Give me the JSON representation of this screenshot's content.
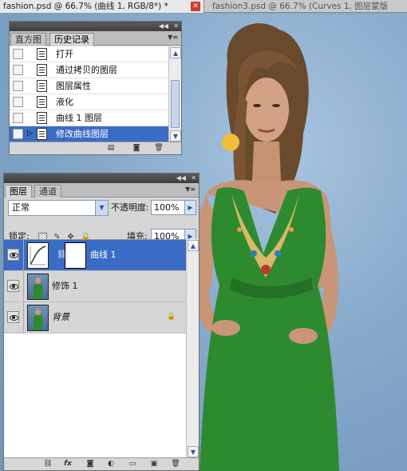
{
  "document_tabs": [
    {
      "label": "fashion.psd @ 66.7% (曲线 1, RGB/8*) *",
      "active": true
    },
    {
      "label": "fashion3.psd @ 66.7% (Curves 1, 图层蒙版",
      "active": false
    }
  ],
  "tab_close_glyph": "✕",
  "history_panel": {
    "tabs": [
      "直方图",
      "历史记录"
    ],
    "active_tab": "历史记录",
    "items": [
      {
        "label": "打开",
        "selected": false
      },
      {
        "label": "通过拷贝的图层",
        "selected": false
      },
      {
        "label": "图层属性",
        "selected": false
      },
      {
        "label": "液化",
        "selected": false
      },
      {
        "label": "曲线 1 图层",
        "selected": false
      },
      {
        "label": "修改曲线图层",
        "selected": true
      }
    ],
    "bottom_buttons": [
      "new-document-from-state",
      "new-snapshot",
      "delete-state"
    ]
  },
  "layers_panel": {
    "tabs": [
      "图层",
      "通道"
    ],
    "active_tab": "图层",
    "blend_mode": "正常",
    "opacity_label": "不透明度:",
    "opacity_value": "100%",
    "lock_label": "锁定:",
    "fill_label": "填充:",
    "fill_value": "100%",
    "layers": [
      {
        "name": "曲线 1",
        "type": "curves-adjustment",
        "selected": true,
        "visible": true
      },
      {
        "name": "修饰 1",
        "type": "pixel",
        "selected": false,
        "visible": true
      },
      {
        "name": "背景",
        "type": "background",
        "selected": false,
        "visible": true,
        "locked": true
      }
    ],
    "bottom_buttons": [
      "link-layers",
      "layer-style",
      "add-mask",
      "new-adjustment-layer",
      "new-group",
      "new-layer",
      "delete-layer"
    ],
    "fx_label": "fx"
  },
  "colors": {
    "selection_blue": "#3b6cc5",
    "panel_gray": "#d6d6d6",
    "canvas_blue": "#86a9cb",
    "dress_green": "#2e8a2f",
    "marker_yellow": "#f2bd3a"
  }
}
